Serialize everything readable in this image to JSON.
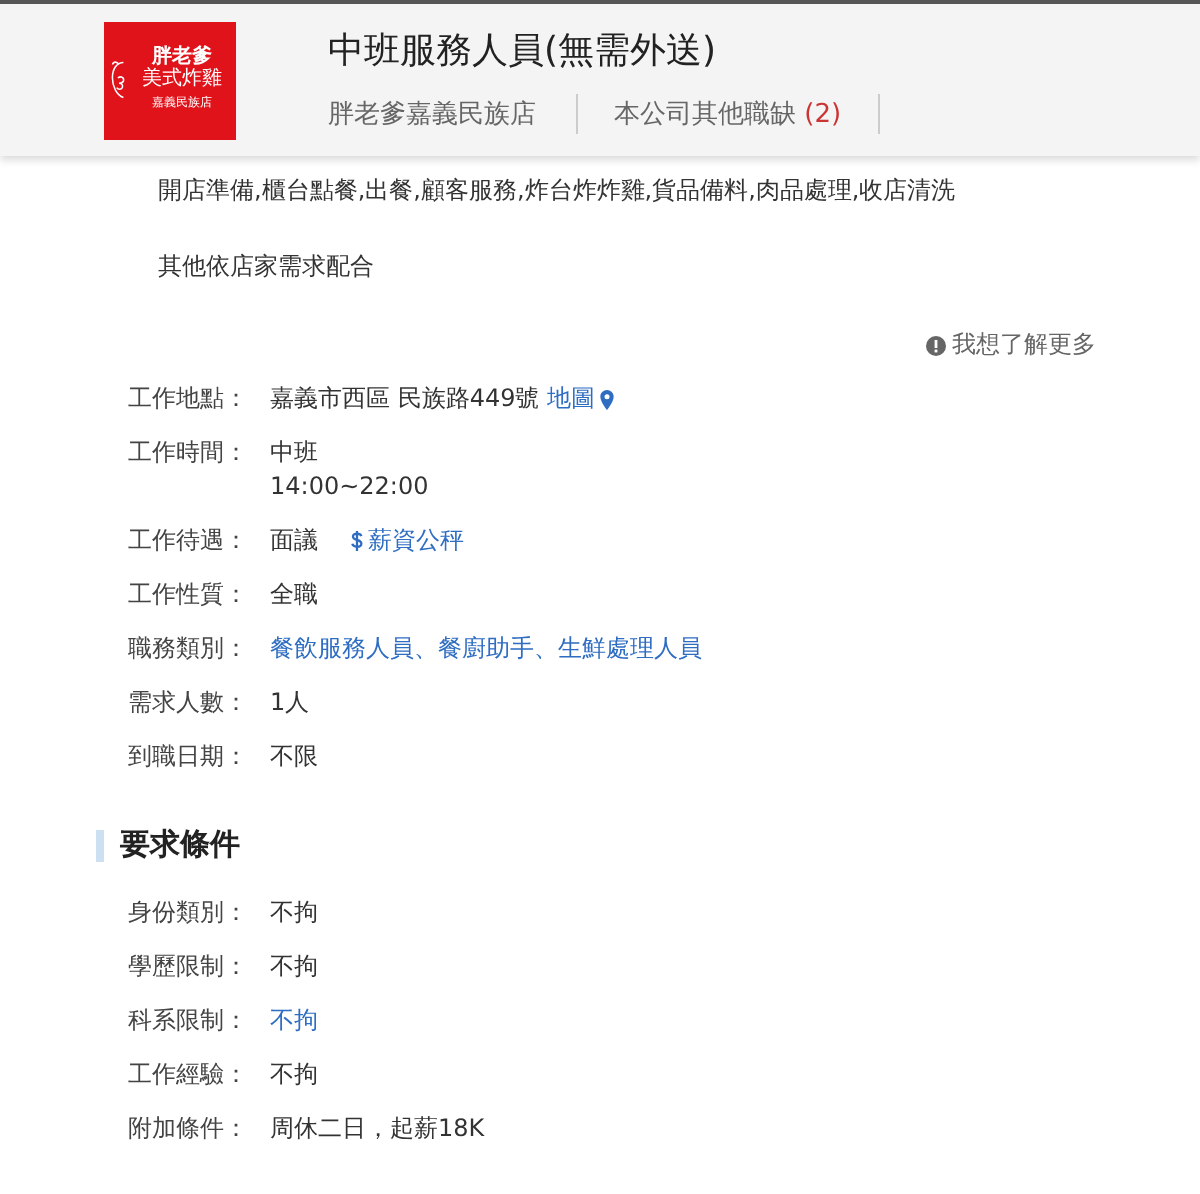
{
  "header": {
    "logo_lines": [
      "胖老爹",
      "美式炸雞",
      "嘉義民族店"
    ],
    "title": "中班服務人員(無需外送)",
    "company": "胖老爹嘉義民族店",
    "other_jobs": {
      "label": "本公司其他職缺",
      "count": "(2)"
    }
  },
  "description": [
    "開店準備,櫃台點餐,出餐,顧客服務,炸台炸炸雞,貨品備料,肉品處理,收店清洗",
    "其他依店家需求配合"
  ],
  "more_link": "我想了解更多",
  "job_details": [
    {
      "label": "工作地點：",
      "values": [
        {
          "text": "嘉義市西區 民族路449號",
          "kind": "text"
        },
        {
          "text": "地圖",
          "kind": "map-link"
        }
      ]
    },
    {
      "label": "工作時間：",
      "values": [
        {
          "text": "中班",
          "kind": "line"
        },
        {
          "text": "14:00~22:00",
          "kind": "line"
        }
      ]
    },
    {
      "label": "工作待遇：",
      "values": [
        {
          "text": "面議",
          "kind": "text"
        },
        {
          "text": "薪資公秤",
          "kind": "salary-link"
        }
      ]
    },
    {
      "label": "工作性質：",
      "values": [
        {
          "text": "全職",
          "kind": "text"
        }
      ]
    },
    {
      "label": "職務類別：",
      "values": [
        {
          "text": "餐飲服務人員、餐廚助手、生鮮處理人員",
          "kind": "link"
        }
      ]
    },
    {
      "label": "需求人數：",
      "values": [
        {
          "text": "1人",
          "kind": "text"
        }
      ]
    },
    {
      "label": "到職日期：",
      "values": [
        {
          "text": "不限",
          "kind": "text"
        }
      ]
    }
  ],
  "requirements_title": "要求條件",
  "requirements": [
    {
      "label": "身份類別：",
      "values": [
        {
          "text": "不拘",
          "kind": "text"
        }
      ]
    },
    {
      "label": "學歷限制：",
      "values": [
        {
          "text": "不拘",
          "kind": "text"
        }
      ]
    },
    {
      "label": "科系限制：",
      "values": [
        {
          "text": "不拘",
          "kind": "link"
        }
      ]
    },
    {
      "label": "工作經驗：",
      "values": [
        {
          "text": "不拘",
          "kind": "text"
        }
      ]
    },
    {
      "label": "附加條件：",
      "values": [
        {
          "text": "周休二日，起薪18K",
          "kind": "text"
        }
      ]
    }
  ]
}
